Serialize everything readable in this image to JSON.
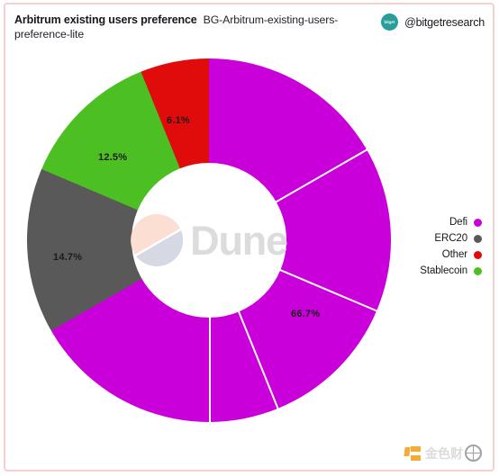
{
  "header": {
    "title": "Arbitrum existing users preference",
    "subtitle": "BG-Arbitrum-existing-users-preference-lite",
    "account_handle": "@bitgetresearch",
    "avatar_text": "bitget"
  },
  "watermarks": {
    "center_brand": "Dune",
    "corner_brand": "金色财"
  },
  "legend": {
    "items": [
      {
        "label": "Defi",
        "color": "#c900d9"
      },
      {
        "label": "ERC20",
        "color": "#595959"
      },
      {
        "label": "Other",
        "color": "#e00b0b"
      },
      {
        "label": "Stablecoin",
        "color": "#4cc022"
      }
    ]
  },
  "chart_data": {
    "type": "pie",
    "variant": "donut",
    "title": "Arbitrum existing users preference",
    "subtitle": "BG-Arbitrum-existing-users-preference-lite",
    "categories": [
      "Defi",
      "ERC20",
      "Stablecoin",
      "Other"
    ],
    "values": [
      66.7,
      14.7,
      12.5,
      6.1
    ],
    "unit": "%",
    "labels": [
      "66.7%",
      "14.7%",
      "12.5%",
      "6.1%"
    ],
    "colors": [
      "#c900d9",
      "#595959",
      "#4cc022",
      "#e00b0b"
    ],
    "legend_order": [
      "Defi",
      "ERC20",
      "Other",
      "Stablecoin"
    ],
    "legend_position": "right",
    "start_angle_deg": 0,
    "direction": "clockwise",
    "inner_radius_ratio": 0.43,
    "grid": false,
    "slices": [
      {
        "name": "Defi",
        "value": 66.7,
        "label": "66.7%",
        "color": "#c900d9",
        "start_deg": 0,
        "end_deg": 240.1
      },
      {
        "name": "ERC20",
        "value": 14.7,
        "label": "14.7%",
        "color": "#595959",
        "start_deg": 240.1,
        "end_deg": 293.0
      },
      {
        "name": "Stablecoin",
        "value": 12.5,
        "label": "12.5%",
        "color": "#4cc022",
        "start_deg": 293.0,
        "end_deg": 338.0
      },
      {
        "name": "Other",
        "value": 6.1,
        "label": "6.1%",
        "color": "#e00b0b",
        "start_deg": 338.0,
        "end_deg": 360.0
      }
    ]
  }
}
